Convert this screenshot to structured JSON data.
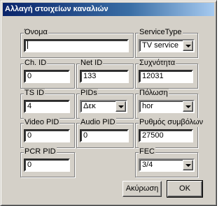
{
  "window": {
    "title": "Αλλαγή στοιχείων καναλιών"
  },
  "fields": {
    "name": {
      "label": "Όνομα",
      "value": ""
    },
    "service_type": {
      "label": "ServiceType",
      "value": "TV service"
    },
    "ch_id": {
      "label": "Ch. ID",
      "value": "0"
    },
    "net_id": {
      "label": "Net ID",
      "value": "133"
    },
    "frequency": {
      "label": "Συχνότητα",
      "value": "12031"
    },
    "ts_id": {
      "label": "TS ID",
      "value": "4"
    },
    "pids": {
      "label": "PIDs",
      "value": "Δεκ"
    },
    "polarization": {
      "label": "Πόλωση",
      "value": "hor"
    },
    "video_pid": {
      "label": "Video PID",
      "value": "0"
    },
    "audio_pid": {
      "label": "Audio PID",
      "value": "0"
    },
    "symbol_rate": {
      "label": "Ρυθμός συμβόλων",
      "value": "27500"
    },
    "pcr_pid": {
      "label": "PCR PID",
      "value": "0"
    },
    "fec": {
      "label": "FEC",
      "value": "3/4"
    }
  },
  "buttons": {
    "cancel": "Ακύρωση",
    "ok": "OK"
  }
}
